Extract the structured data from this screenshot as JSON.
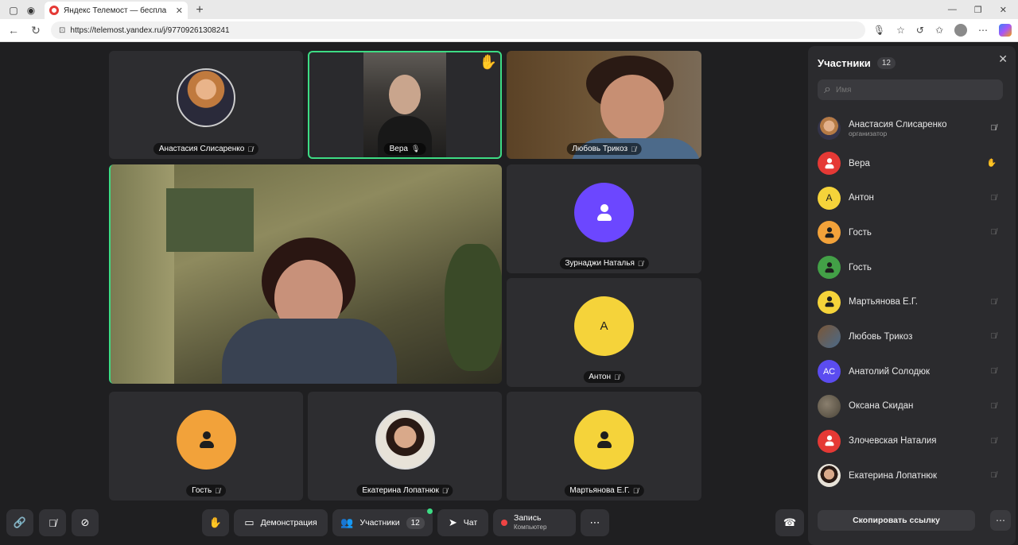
{
  "browser": {
    "tab_title": "Яндекс Телемост — беспла",
    "url": "https://telemost.yandex.ru/j/97709261308241"
  },
  "tiles": {
    "t1": {
      "name": "Анастасия Слисаренко"
    },
    "t2": {
      "name": "Вера"
    },
    "t3": {
      "name": "Любовь Трикоз"
    },
    "t5": {
      "name": "Зурнаджи Наталья"
    },
    "t6": {
      "name": "Антон",
      "letter": "А"
    },
    "t7": {
      "name": "Гость"
    },
    "t8": {
      "name": "Екатерина Лопатнюк"
    },
    "t9": {
      "name": "Мартьянова Е.Г."
    }
  },
  "sidebar": {
    "title": "Участники",
    "count": "12",
    "search_placeholder": "Имя",
    "participants": [
      {
        "name": "Анастасия Слисаренко",
        "sub": "организатор"
      },
      {
        "name": "Вера"
      },
      {
        "name": "Антон",
        "letter": "А"
      },
      {
        "name": "Гость"
      },
      {
        "name": "Гость"
      },
      {
        "name": "Мартьянова Е.Г."
      },
      {
        "name": "Любовь Трикоз"
      },
      {
        "name": "Анатолий Солодюк",
        "letter": "АС"
      },
      {
        "name": "Оксана Скидан"
      },
      {
        "name": "Злочевская Наталия"
      },
      {
        "name": "Екатерина Лопатнюк"
      }
    ],
    "copy_link": "Скопировать ссылку"
  },
  "controls": {
    "demo": "Демонстрация",
    "participants": "Участники",
    "participants_count": "12",
    "chat": "Чат",
    "record": "Запись",
    "record_sub": "Компьютер"
  },
  "colors": {
    "active_border": "#3ddc84",
    "avatar_purple": "#6c47ff",
    "avatar_yellow": "#f5d33a",
    "avatar_orange": "#f2a23a",
    "avatar_red": "#e53935",
    "avatar_green": "#43a047"
  }
}
